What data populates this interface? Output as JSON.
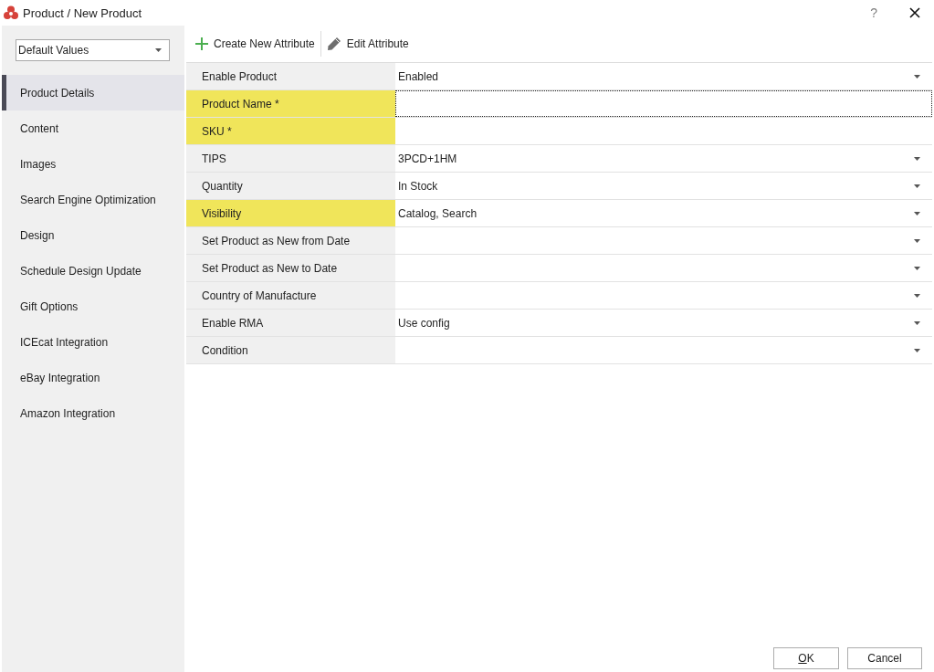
{
  "window": {
    "title": "Product / New Product",
    "help": "?"
  },
  "sidebar": {
    "store_select": {
      "value": "Default Values"
    },
    "items": [
      {
        "label": "Product Details",
        "selected": true
      },
      {
        "label": "Content",
        "selected": false
      },
      {
        "label": "Images",
        "selected": false
      },
      {
        "label": "Search Engine Optimization",
        "selected": false
      },
      {
        "label": "Design",
        "selected": false
      },
      {
        "label": "Schedule Design Update",
        "selected": false
      },
      {
        "label": "Gift Options",
        "selected": false
      },
      {
        "label": "ICEcat Integration",
        "selected": false
      },
      {
        "label": "eBay Integration",
        "selected": false
      },
      {
        "label": "Amazon Integration",
        "selected": false
      }
    ]
  },
  "toolbar": [
    {
      "kind": "create",
      "label": "Create New Attribute"
    },
    {
      "kind": "edit",
      "label": "Edit Attribute"
    }
  ],
  "attributes": [
    {
      "label": "Enable Product",
      "kind": "dropdown",
      "value": "Enabled",
      "highlighted": false,
      "focused": false
    },
    {
      "label": "Product Name *",
      "kind": "text",
      "highlighted": true,
      "focused": true
    },
    {
      "label": "SKU *",
      "kind": "text",
      "highlighted": true,
      "focused": false
    },
    {
      "label": "TIPS",
      "kind": "dropdown",
      "value": "3PCD+1HM",
      "highlighted": false,
      "focused": false
    },
    {
      "label": "Quantity",
      "kind": "dropdown",
      "value": "In Stock",
      "highlighted": false,
      "focused": false
    },
    {
      "label": "Visibility",
      "kind": "dropdown",
      "value": "Catalog, Search",
      "highlighted": true,
      "focused": false
    },
    {
      "label": "Set Product as New from Date",
      "kind": "dropdown",
      "highlighted": false,
      "focused": false
    },
    {
      "label": "Set Product as New to Date",
      "kind": "dropdown",
      "highlighted": false,
      "focused": false
    },
    {
      "label": "Country of Manufacture",
      "kind": "dropdown",
      "highlighted": false,
      "focused": false
    },
    {
      "label": "Enable RMA",
      "kind": "dropdown",
      "value": "Use config",
      "highlighted": false,
      "focused": false
    },
    {
      "label": "Condition",
      "kind": "dropdown",
      "highlighted": false,
      "focused": false
    }
  ],
  "buttons": [
    {
      "label": "OK",
      "underline_first": true
    },
    {
      "label": "Cancel",
      "underline_first": false
    }
  ]
}
